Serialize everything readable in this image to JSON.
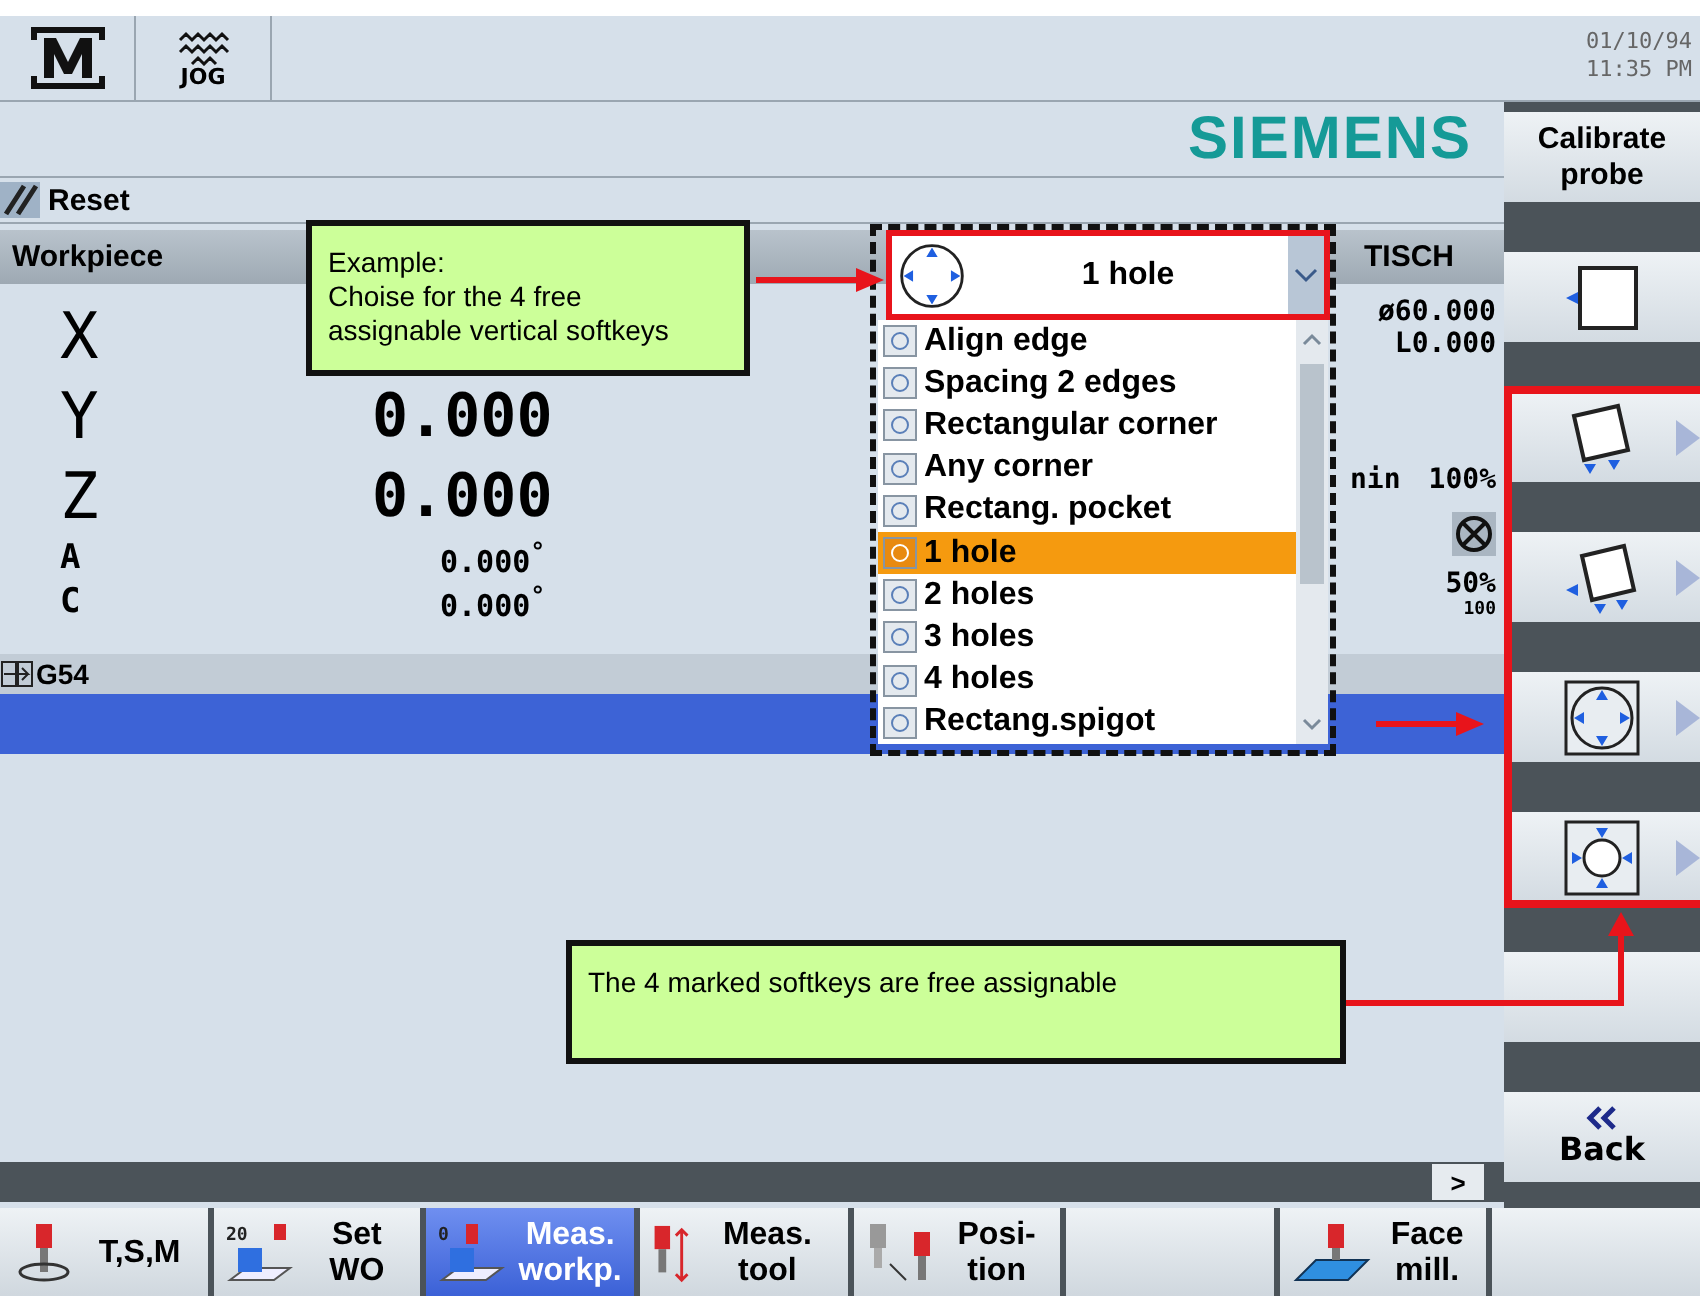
{
  "header": {
    "mode": "JOG",
    "date": "01/10/94",
    "time": "11:35 PM"
  },
  "logo": "SIEMENS",
  "status": {
    "reset": "Reset"
  },
  "position": {
    "title": "Workpiece",
    "axes": [
      {
        "name": "X",
        "kind": "linear"
      },
      {
        "name": "Y",
        "value": "0.000",
        "kind": "linear"
      },
      {
        "name": "Z",
        "value": "0.000",
        "kind": "linear"
      },
      {
        "name": "A",
        "value": "0.000",
        "unit": "°",
        "kind": "rotary"
      },
      {
        "name": "C",
        "value": "0.000",
        "unit": "°",
        "kind": "rotary"
      }
    ],
    "frame": "G54"
  },
  "tool": {
    "name": "TISCH",
    "diameter": "ø60.000",
    "length": "L0.000",
    "feed_label": "nin",
    "feed": "100%",
    "spindle": "50%",
    "spindle_scale": "100"
  },
  "dropdown": {
    "value": "1 hole",
    "items": [
      {
        "label": "Align edge",
        "selected": false
      },
      {
        "label": "Spacing 2 edges",
        "selected": false
      },
      {
        "label": "Rectangular corner",
        "selected": false
      },
      {
        "label": "Any corner",
        "selected": false
      },
      {
        "label": "Rectang. pocket",
        "selected": false
      },
      {
        "label": "1 hole",
        "selected": true
      },
      {
        "label": "2 holes",
        "selected": false
      },
      {
        "label": "3 holes",
        "selected": false
      },
      {
        "label": "4 holes",
        "selected": false
      },
      {
        "label": "Rectang.spigot",
        "selected": false
      }
    ]
  },
  "vertical_softkeys": [
    {
      "kind": "text",
      "label": "Calibrate probe"
    },
    {
      "kind": "edge"
    },
    {
      "kind": "tilted"
    },
    {
      "kind": "corner"
    },
    {
      "kind": "hole"
    },
    {
      "kind": "spigot"
    },
    {
      "kind": "empty"
    },
    {
      "kind": "back",
      "label": "Back"
    }
  ],
  "next_button": ">",
  "horizontal_softkeys": [
    {
      "kind": "tsm",
      "label": "T,S,M",
      "selected": false
    },
    {
      "kind": "setwo",
      "label": "Set\nWO",
      "badge": "20",
      "selected": false
    },
    {
      "kind": "measwork",
      "label": "Meas.\nworkp.",
      "badge": "0",
      "selected": true
    },
    {
      "kind": "meastool",
      "label": "Meas.\ntool",
      "selected": false
    },
    {
      "kind": "position",
      "label": "Posi-\ntion",
      "selected": false
    },
    {
      "kind": "empty",
      "selected": false
    },
    {
      "kind": "facemill",
      "label": "Face\nmill.",
      "selected": false
    },
    {
      "kind": "empty",
      "selected": false
    }
  ],
  "callouts": [
    {
      "text": "Example:\nChoise for the 4 free\nassignable vertical softkeys"
    },
    {
      "text": "The 4 marked softkeys are free assignable"
    }
  ]
}
